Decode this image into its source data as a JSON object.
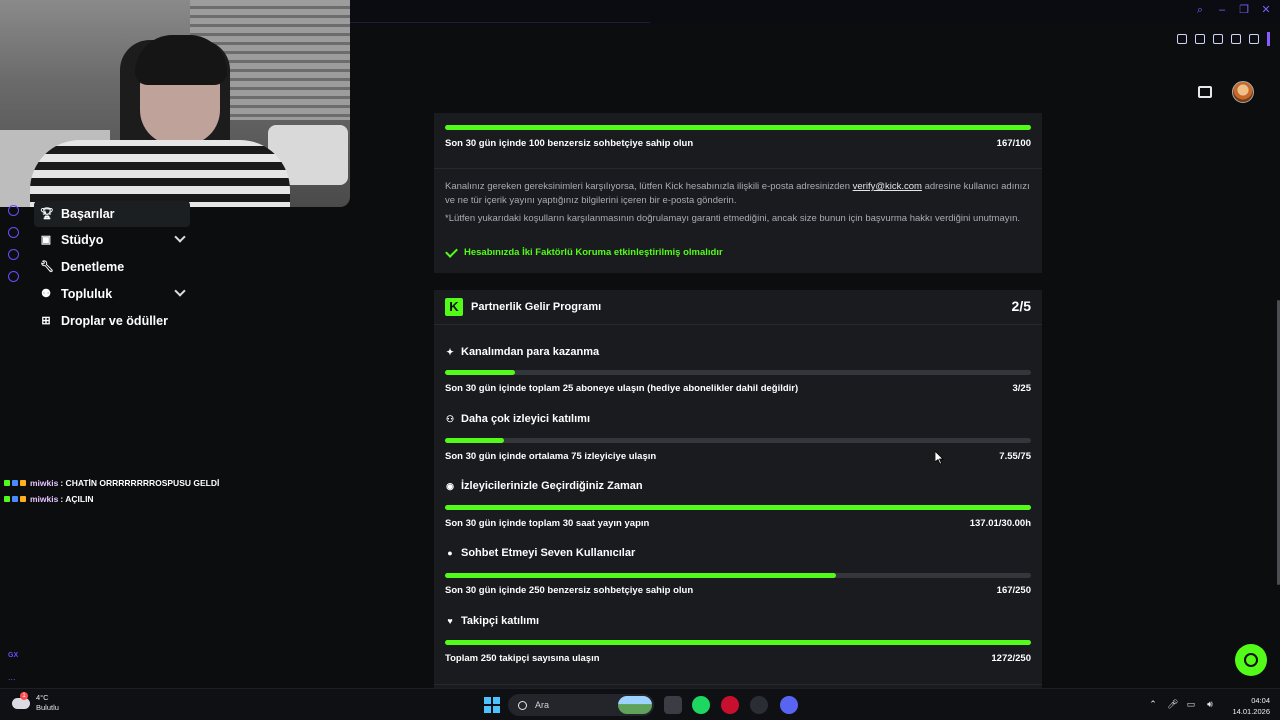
{
  "sidebar": {
    "items": [
      {
        "label": "Başarılar",
        "icon": "trophy-icon"
      },
      {
        "label": "Stüdyo",
        "icon": "studio-icon"
      },
      {
        "label": "Denetleme",
        "icon": "wrench-icon"
      },
      {
        "label": "Topluluk",
        "icon": "community-icon"
      },
      {
        "label": "Droplar ve ödüller",
        "icon": "gift-icon"
      }
    ]
  },
  "chat": {
    "messages": [
      {
        "user": "miwkis",
        "text": ": CHATİN ORRRRRRRROSPUSU GELDİ"
      },
      {
        "user": "miwkis",
        "text": ": AÇILIN"
      }
    ],
    "gx_label": "GX",
    "more": "..."
  },
  "top_requirement": {
    "text": "Son 30 gün içinde 100 benzersiz sohbetçiye sahip olun",
    "value": "167/100",
    "progress": 1.0
  },
  "info": {
    "paragraph1_pre": "Kanalınız gereken gereksinimleri karşılıyorsa, lütfen Kick hesabınızla ilişkili e-posta adresinizden ",
    "email": "verify@kick.com",
    "paragraph1_post": " adresine kullanıcı adınızı ve ne tür içerik yayını yaptığınız bilgilerini içeren bir e-posta gönderin.",
    "paragraph2": "*Lütfen yukarıdaki koşulların karşılanmasının doğrulamayı garanti etmediğini, ancak size bunun için başvurma hakkı verdiğini unutmayın.",
    "two_factor": "Hesabınızda İki Faktörlü Koruma etkinleştirilmiş olmalıdır"
  },
  "program": {
    "title": "Partnerlik Gelir Programı",
    "count": "2/5",
    "logo_letter": "K",
    "sections": [
      {
        "title": "Kanalımdan para kazanma",
        "icon": "sparkle-icon",
        "text": "Son 30 gün içinde toplam 25 aboneye ulaşın (hediye abonelikler dahil değildir)",
        "value": "3/25",
        "progress": 0.12
      },
      {
        "title": "Daha çok izleyici katılımı",
        "icon": "viewers-icon",
        "text": "Son 30 gün içinde ortalama 75 izleyiciye ulaşın",
        "value": "7.55/75",
        "progress": 0.1
      },
      {
        "title": "İzleyicilerinizle Geçirdiğiniz Zaman",
        "icon": "broadcast-icon",
        "text": "Son 30 gün içinde toplam 30 saat yayın yapın",
        "value": "137.01/30.00h",
        "progress": 1.0
      },
      {
        "title": "Sohbet Etmeyi Seven Kullanıcılar",
        "icon": "chat-bubble-icon",
        "text": "Son 30 gün içinde 250 benzersiz sohbetçiye sahip olun",
        "value": "167/250",
        "progress": 0.668
      },
      {
        "title": "Takipçi katılımı",
        "icon": "heart-icon",
        "text": "Toplam 250 takipçi sayısına ulaşın",
        "value": "1272/250",
        "progress": 1.0
      }
    ]
  },
  "taskbar": {
    "temperature": "4°C",
    "condition": "Bulutlu",
    "weather_badge": "1",
    "search_placeholder": "Ara",
    "time": "04:04",
    "date": "14.01.2026"
  },
  "colors": {
    "accent": "#53fc18",
    "card_bg": "#191b1f",
    "page_bg": "#0b0d0f",
    "gx_purple": "#7d5cff"
  }
}
